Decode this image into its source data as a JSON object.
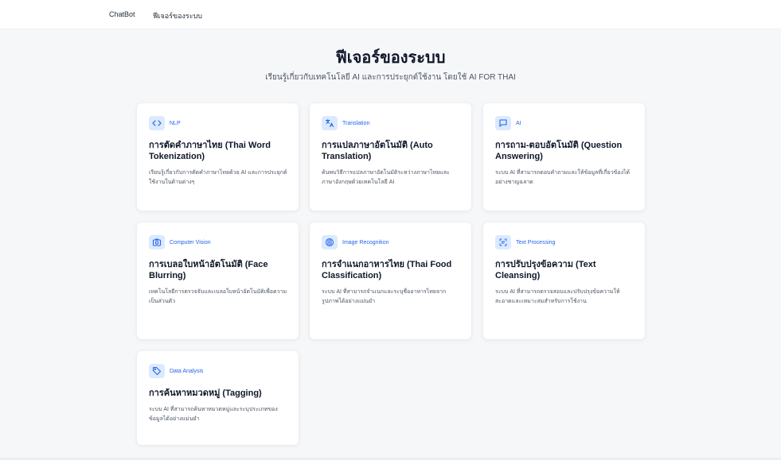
{
  "nav": {
    "brand": "ChatBot",
    "features": "ฟีเจอร์ของระบบ"
  },
  "hero": {
    "title": "ฟีเจอร์ของระบบ",
    "subtitle": "เรียนรู้เกี่ยวกับเทคโนโลยี AI และการประยุกต์ใช้งาน โดยใช้ AI FOR THAI"
  },
  "colors": {
    "accent": "#2563eb",
    "icon_bg": "#dbeafe",
    "page_bg": "#f6f7f9"
  },
  "cards": [
    {
      "icon": "code-icon",
      "category": "NLP",
      "title": "การตัดคำภาษาไทย (Thai Word Tokenization)",
      "desc": "เรียนรู้เกี่ยวกับการตัดคำภาษาไทยด้วย AI และการประยุกต์ใช้งานในด้านต่างๆ"
    },
    {
      "icon": "translate-icon",
      "category": "Translation",
      "title": "การแปลภาษาอัตโนมัติ (Auto Translation)",
      "desc": "ค้นพบวิธีการแปลภาษาอัตโนมัติระหว่างภาษาไทยและภาษาอังกฤษด้วยเทคโนโลยี AI"
    },
    {
      "icon": "chat-bubble-icon",
      "category": "AI",
      "title": "การถาม-ตอบอัตโนมัติ (Question Answering)",
      "desc": "ระบบ AI ที่สามารถตอบคำถามและให้ข้อมูลที่เกี่ยวข้องได้อย่างชาญฉลาด"
    },
    {
      "icon": "camera-icon",
      "category": "Computer Vision",
      "title": "การเบลอใบหน้าอัตโนมัติ (Face Blurring)",
      "desc": "เทคโนโลยีการตรวจจับและเบลอใบหน้าอัตโนมัติเพื่อความเป็นส่วนตัว"
    },
    {
      "icon": "aperture-icon",
      "category": "Image Recognition",
      "title": "การจำแนกอาหารไทย (Thai Food Classification)",
      "desc": "ระบบ AI ที่สามารถจำแนกและระบุชื่ออาหารไทยจากรูปภาพได้อย่างแม่นยำ"
    },
    {
      "icon": "text-scan-icon",
      "category": "Text Processing",
      "title": "การปรับปรุงข้อความ (Text Cleansing)",
      "desc": "ระบบ AI ที่สามารถตรวจสอบและปรับปรุงข้อความให้สะอาดและเหมาะสมสำหรับการใช้งาน"
    },
    {
      "icon": "tag-icon",
      "category": "Data Analysis",
      "title": "การค้นหาหมวดหมู่ (Tagging)",
      "desc": "ระบบ AI ที่สามารถค้นหาหมวดหมู่และระบุประเภทของข้อมูลได้อย่างแม่นยำ"
    }
  ]
}
